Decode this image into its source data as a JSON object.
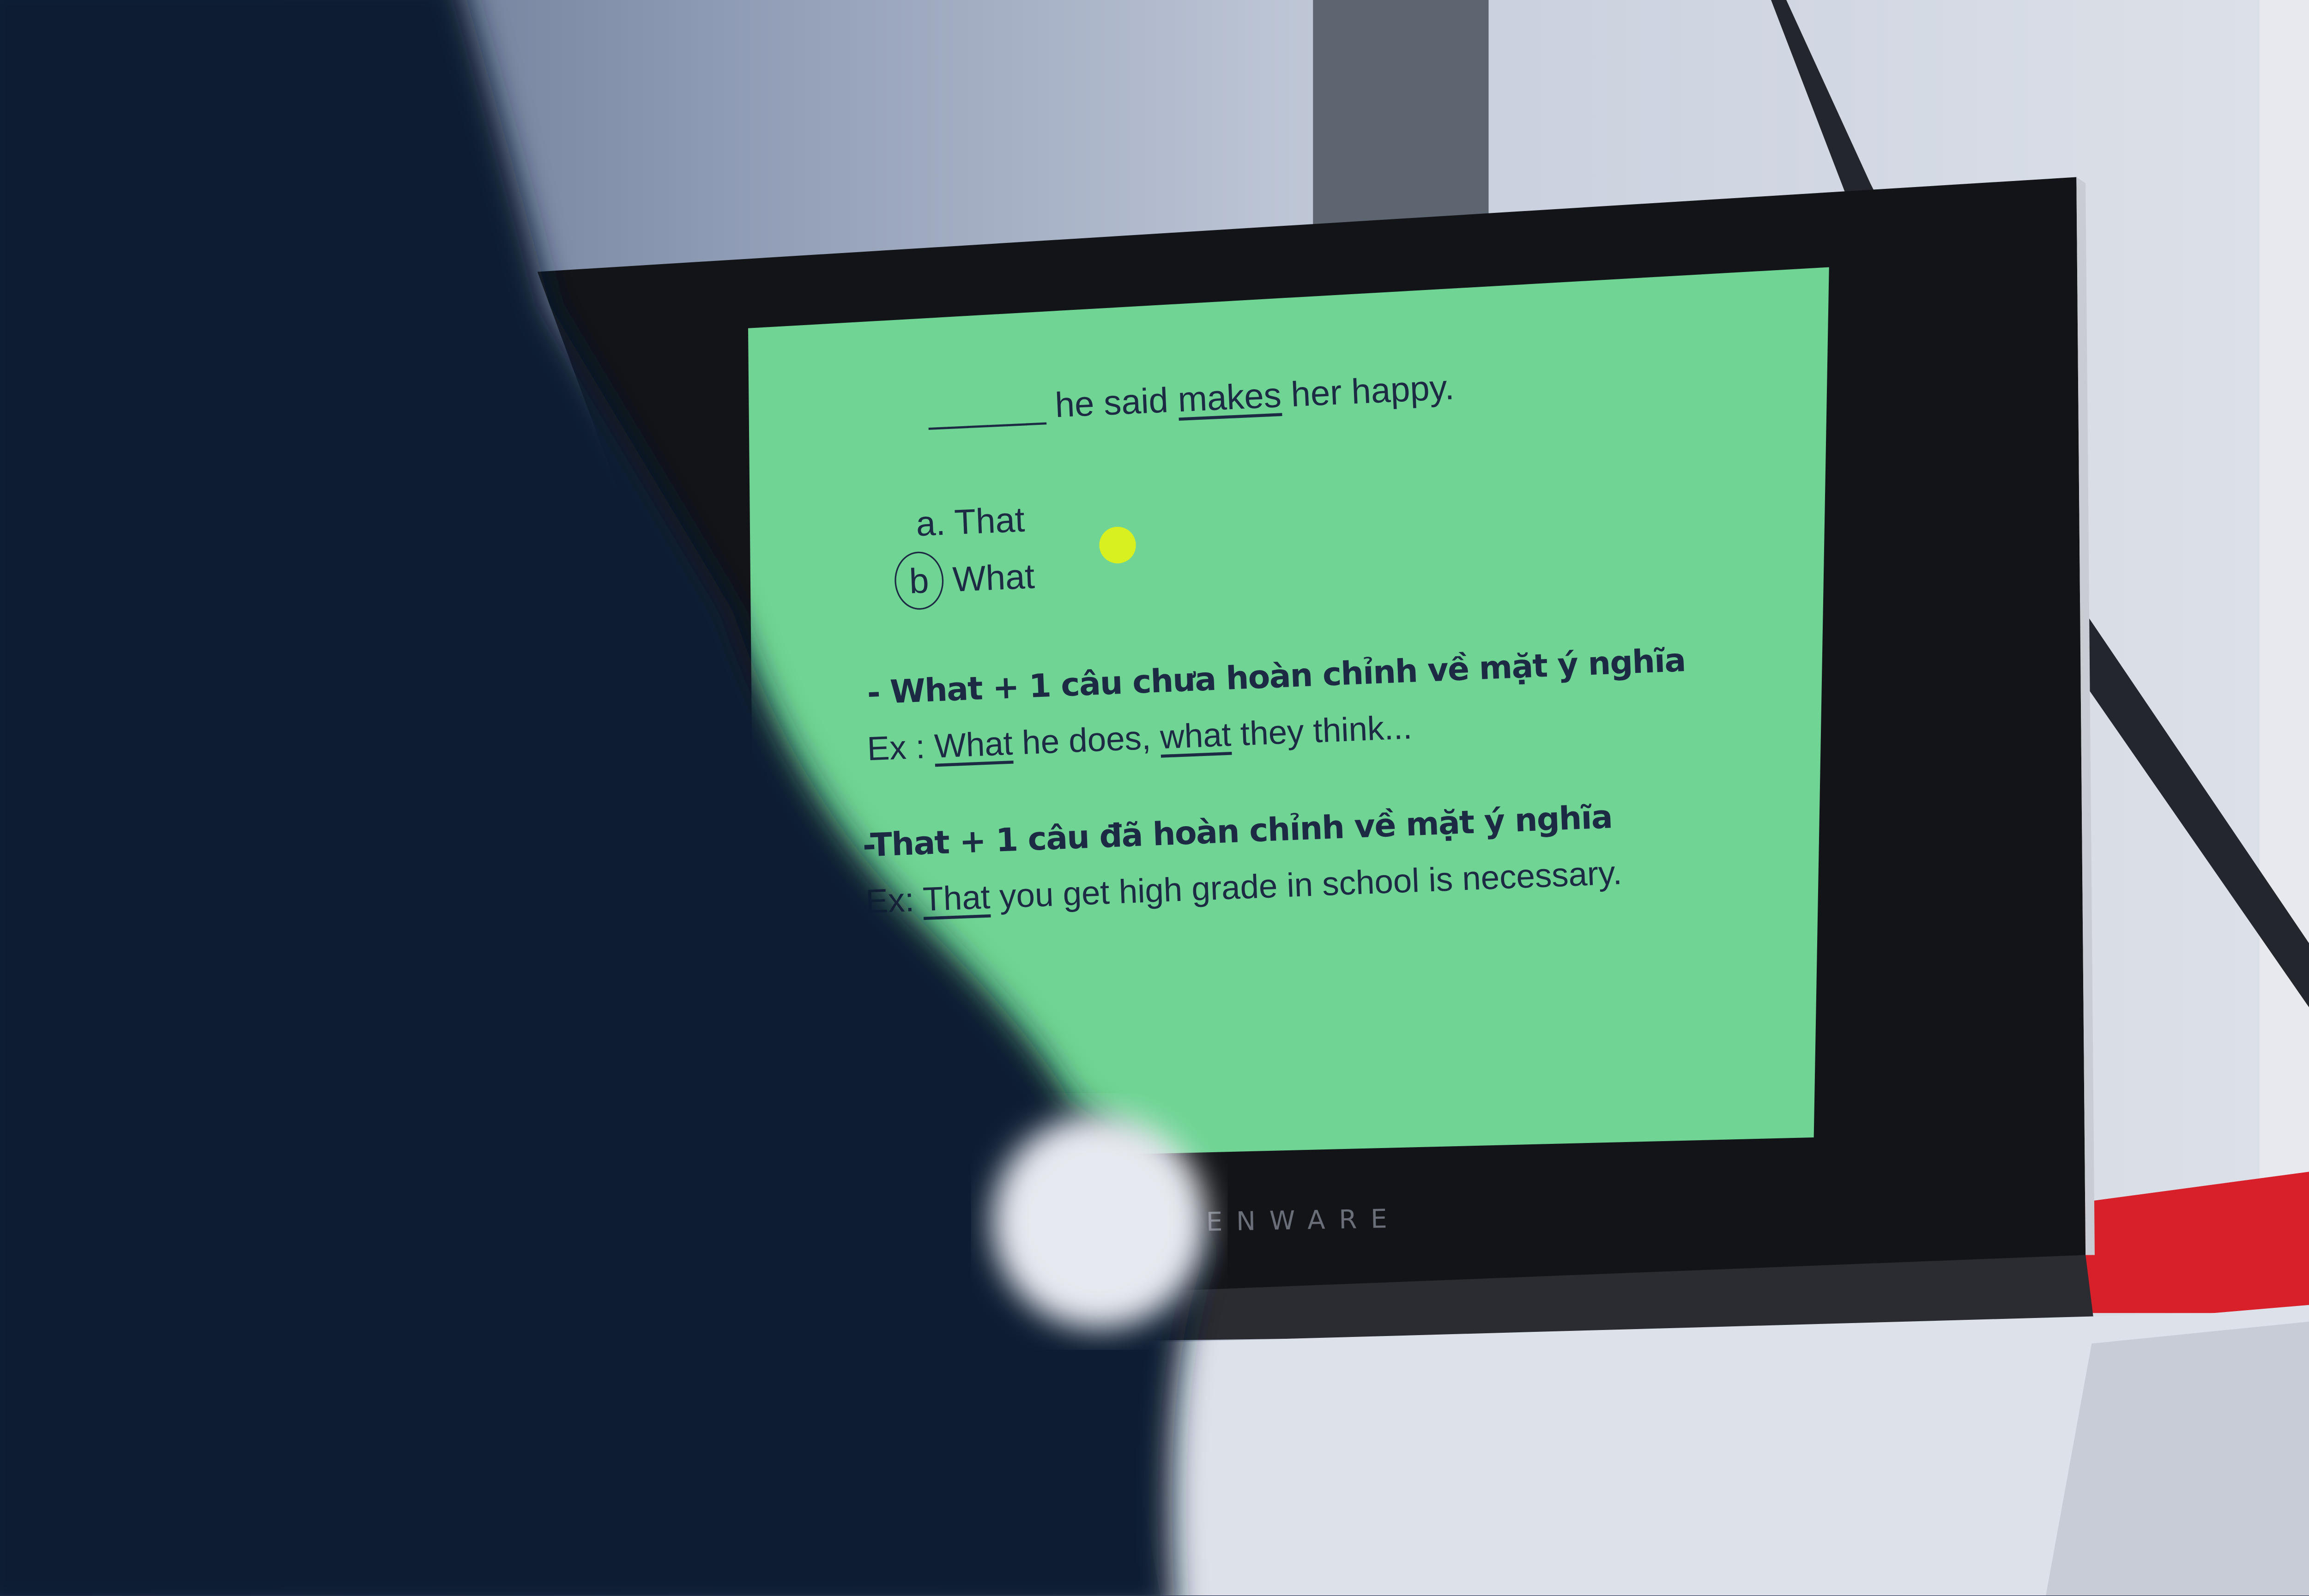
{
  "slide": {
    "question": {
      "blank": "______",
      "pre": "he said",
      "underlined": "makes",
      "post": "her happy."
    },
    "options": [
      {
        "letter": "a.",
        "text": "That",
        "selected": false
      },
      {
        "letter": "b",
        "text": "What",
        "selected": true
      }
    ],
    "rule_what": "- What + 1 câu chưa hoàn chỉnh về mặt ý nghĩa",
    "example_what": {
      "prefix": "Ex :",
      "u1": "What",
      "mid": "he does,",
      "u2": "what",
      "end": "they think..."
    },
    "rule_that": "-That + 1 câu đã hoàn chỉnh về mặt ý nghĩa",
    "example_that": {
      "prefix": "Ex:",
      "u1": "That",
      "end": "you get high grade in school is necessary."
    },
    "background_color": "#6fd494",
    "pointer_color": "#d9f020"
  },
  "laptop": {
    "logo": "ENWARE"
  }
}
